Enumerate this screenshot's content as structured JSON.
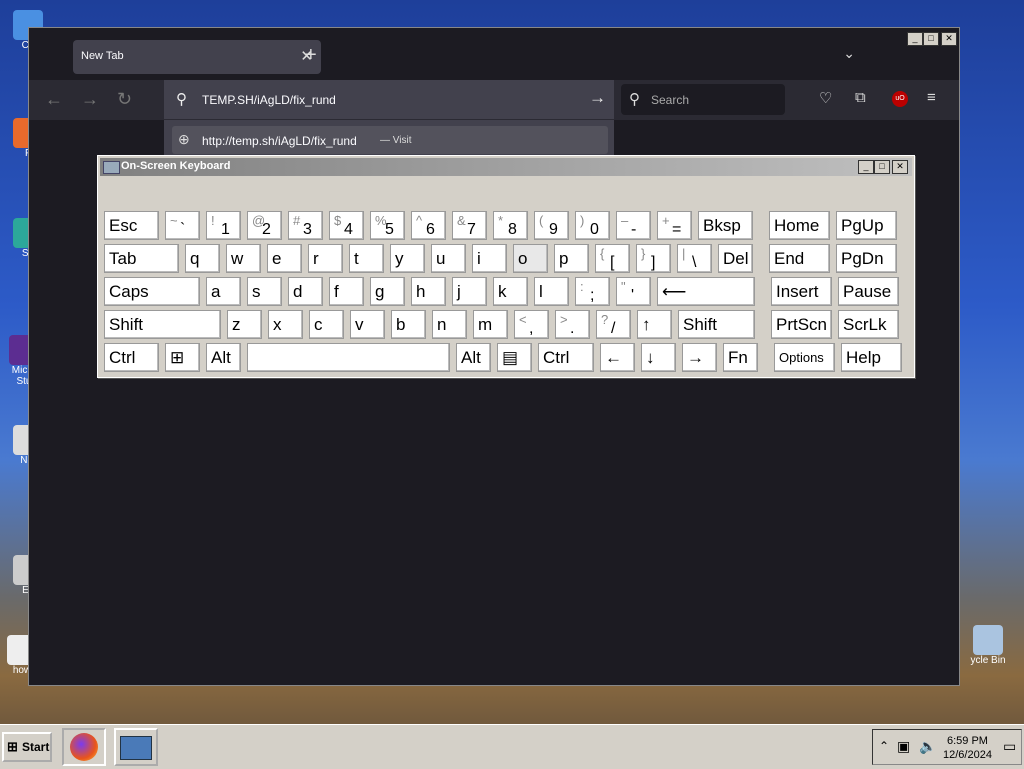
{
  "desktop": {
    "icons": [
      {
        "label": "Co",
        "color": "#4a90e2"
      },
      {
        "label": "F",
        "color": "#e86a2c"
      },
      {
        "label": "Su",
        "color": "#2ca89a"
      },
      {
        "label": "Micro Stu",
        "color": "#5c2d91"
      },
      {
        "label": "Not",
        "color": "#dddddd"
      },
      {
        "label": "Ev",
        "color": "#cccccc"
      },
      {
        "label": "how",
        "color": "#eeeeee"
      },
      {
        "label": "ycle Bin",
        "color": "#aac4e0"
      }
    ]
  },
  "browser": {
    "tab_title": "New Tab",
    "tab_close": "✕",
    "new_tab": "+",
    "tab_list": "⌄",
    "window_controls": [
      "_",
      "□",
      "✕"
    ],
    "nav": {
      "back": "←",
      "forward": "→",
      "reload": "↻"
    },
    "url": "TEMP.SH/iAgLD/fix_rund",
    "go_arrow": "→",
    "search_placeholder": "Search",
    "suggestion_url": "http://temp.sh/iAgLD/fix_rund",
    "suggestion_action": "— Visit",
    "ublock_label": "uO"
  },
  "osk": {
    "title": "On-Screen Keyboard",
    "controls": [
      "_",
      "□",
      "✕"
    ],
    "rows": [
      [
        {
          "main": "Esc",
          "w": 58
        },
        {
          "shift": "~",
          "base": "`",
          "w": 38
        },
        {
          "shift": "!",
          "base": "1",
          "w": 38
        },
        {
          "shift": "@",
          "base": "2",
          "w": 38
        },
        {
          "shift": "#",
          "base": "3",
          "w": 38
        },
        {
          "shift": "$",
          "base": "4",
          "w": 38
        },
        {
          "shift": "%",
          "base": "5",
          "w": 38
        },
        {
          "shift": "^",
          "base": "6",
          "w": 38
        },
        {
          "shift": "&",
          "base": "7",
          "w": 38
        },
        {
          "shift": "*",
          "base": "8",
          "w": 38
        },
        {
          "shift": "(",
          "base": "9",
          "w": 38
        },
        {
          "shift": ")",
          "base": "0",
          "w": 38
        },
        {
          "shift": "–",
          "base": "-",
          "w": 38
        },
        {
          "shift": "+",
          "base": "=",
          "w": 38
        },
        {
          "main": "Bksp",
          "w": 58
        },
        {
          "main": "Home",
          "w": 64,
          "gap": 10
        },
        {
          "main": "PgUp",
          "w": 64
        }
      ],
      [
        {
          "main": "Tab",
          "w": 78
        },
        {
          "main": "q",
          "w": 38
        },
        {
          "main": "w",
          "w": 38
        },
        {
          "main": "e",
          "w": 38
        },
        {
          "main": "r",
          "w": 38
        },
        {
          "main": "t",
          "w": 38
        },
        {
          "main": "y",
          "w": 38
        },
        {
          "main": "u",
          "w": 38
        },
        {
          "main": "i",
          "w": 38
        },
        {
          "main": "o",
          "w": 38,
          "hl": true
        },
        {
          "main": "p",
          "w": 38
        },
        {
          "shift": "{",
          "base": "[",
          "w": 38
        },
        {
          "shift": "}",
          "base": "]",
          "w": 38
        },
        {
          "shift": "|",
          "base": "\\",
          "w": 38
        },
        {
          "main": "Del",
          "w": 38
        },
        {
          "main": "End",
          "w": 64,
          "gap": 10
        },
        {
          "main": "PgDn",
          "w": 64
        }
      ],
      [
        {
          "main": "Caps",
          "w": 99
        },
        {
          "main": "a",
          "w": 38
        },
        {
          "main": "s",
          "w": 38
        },
        {
          "main": "d",
          "w": 38
        },
        {
          "main": "f",
          "w": 38
        },
        {
          "main": "g",
          "w": 38
        },
        {
          "main": "h",
          "w": 38
        },
        {
          "main": "j",
          "w": 38
        },
        {
          "main": "k",
          "w": 38
        },
        {
          "main": "l",
          "w": 38
        },
        {
          "shift": ":",
          "base": ";",
          "w": 38
        },
        {
          "shift": "\"",
          "base": "'",
          "w": 38
        },
        {
          "main": "⟵",
          "w": 101
        },
        {
          "main": "Insert",
          "w": 64,
          "gap": 10
        },
        {
          "main": "Pause",
          "w": 64
        }
      ],
      [
        {
          "main": "Shift",
          "w": 120
        },
        {
          "main": "z",
          "w": 38
        },
        {
          "main": "x",
          "w": 38
        },
        {
          "main": "c",
          "w": 38
        },
        {
          "main": "v",
          "w": 38
        },
        {
          "main": "b",
          "w": 38
        },
        {
          "main": "n",
          "w": 38
        },
        {
          "main": "m",
          "w": 38
        },
        {
          "shift": "<",
          "base": ",",
          "w": 38
        },
        {
          "shift": ">",
          "base": ".",
          "w": 38
        },
        {
          "shift": "?",
          "base": "/",
          "w": 38
        },
        {
          "main": "↑",
          "w": 38
        },
        {
          "main": "Shift",
          "w": 80
        },
        {
          "main": "PrtScn",
          "w": 64,
          "gap": 10
        },
        {
          "main": "ScrLk",
          "w": 64
        }
      ],
      [
        {
          "main": "Ctrl",
          "w": 58
        },
        {
          "main": "⊞",
          "w": 38
        },
        {
          "main": "Alt",
          "w": 38
        },
        {
          "main": "",
          "w": 206
        },
        {
          "main": "Alt",
          "w": 38
        },
        {
          "main": "▤",
          "w": 38
        },
        {
          "main": "Ctrl",
          "w": 59
        },
        {
          "main": "←",
          "w": 38
        },
        {
          "main": "↓",
          "w": 38
        },
        {
          "main": "→",
          "w": 38
        },
        {
          "main": "Fn",
          "w": 38
        },
        {
          "main": "Options",
          "w": 64,
          "gap": 10,
          "small": true
        },
        {
          "main": "Help",
          "w": 64
        }
      ]
    ]
  },
  "taskbar": {
    "start_label": "Start",
    "start_logo": "⊞",
    "tray_up": "⌃",
    "time": "6:59 PM",
    "date": "12/6/2024"
  }
}
